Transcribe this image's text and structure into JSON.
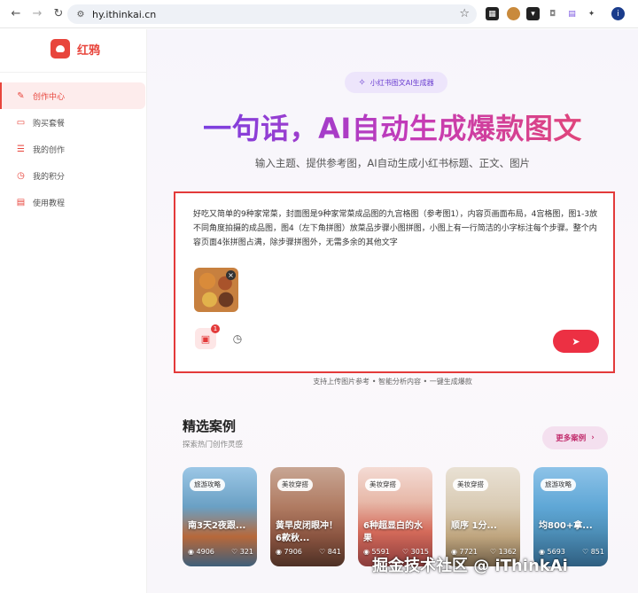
{
  "browser": {
    "url": "hy.ithinkai.cn",
    "icons": [
      "back-icon",
      "forward-icon",
      "reload-icon",
      "site-settings-icon",
      "bookmark-star-icon",
      "extensions-icon"
    ]
  },
  "sidebar": {
    "logo_text": "红鸦",
    "items": [
      {
        "label": "创作中心",
        "icon": "edit-icon",
        "active": true
      },
      {
        "label": "购买套餐",
        "icon": "wallet-icon",
        "active": false
      },
      {
        "label": "我的创作",
        "icon": "list-icon",
        "active": false
      },
      {
        "label": "我的积分",
        "icon": "clock-icon",
        "active": false
      },
      {
        "label": "使用教程",
        "icon": "document-icon",
        "active": false
      }
    ]
  },
  "main": {
    "badge": "小红书图文AI生成器",
    "headline": "一句话，AI自动生成爆款图文",
    "subtitle": "输入主题、提供参考图，AI自动生成小红书标题、正文、图片",
    "prompt": "好吃又简单的9种家常菜，封面图是9种家常菜成品图的九宫格图（参考图1），内容页画面布局，4宫格图，图1-3放不同角度拍摄的成品图，图4（左下角拼图）放菜品步骤小图拼图，小图上有一行简洁的小字标注每个步骤。整个内容页面4张拼图占满，除步骤拼图外，无需多余的其他文字",
    "image_count": "1",
    "hint": "支持上传图片参考 • 智能分析内容 • 一键生成爆款",
    "cases_title": "精选案例",
    "cases_subtitle": "探索热门创作灵感",
    "more_label": "更多案例",
    "cards": [
      {
        "tag": "旅游攻略",
        "title": "南3天2夜跟...",
        "views": "4906",
        "likes": "321"
      },
      {
        "tag": "美妆穿搭",
        "title": "黄早皮闭眼冲！6款秋...",
        "views": "7906",
        "likes": "841"
      },
      {
        "tag": "美妆穿搭",
        "title": "6种超显白的水果",
        "views": "5591",
        "likes": "3015"
      },
      {
        "tag": "美妆穿搭",
        "title": "顺序 1分...",
        "views": "7721",
        "likes": "1362"
      },
      {
        "tag": "旅游攻略",
        "title": "均800+拿...",
        "views": "5693",
        "likes": "851"
      }
    ]
  },
  "watermark": "掘金技术社区 @ iThinkAi"
}
